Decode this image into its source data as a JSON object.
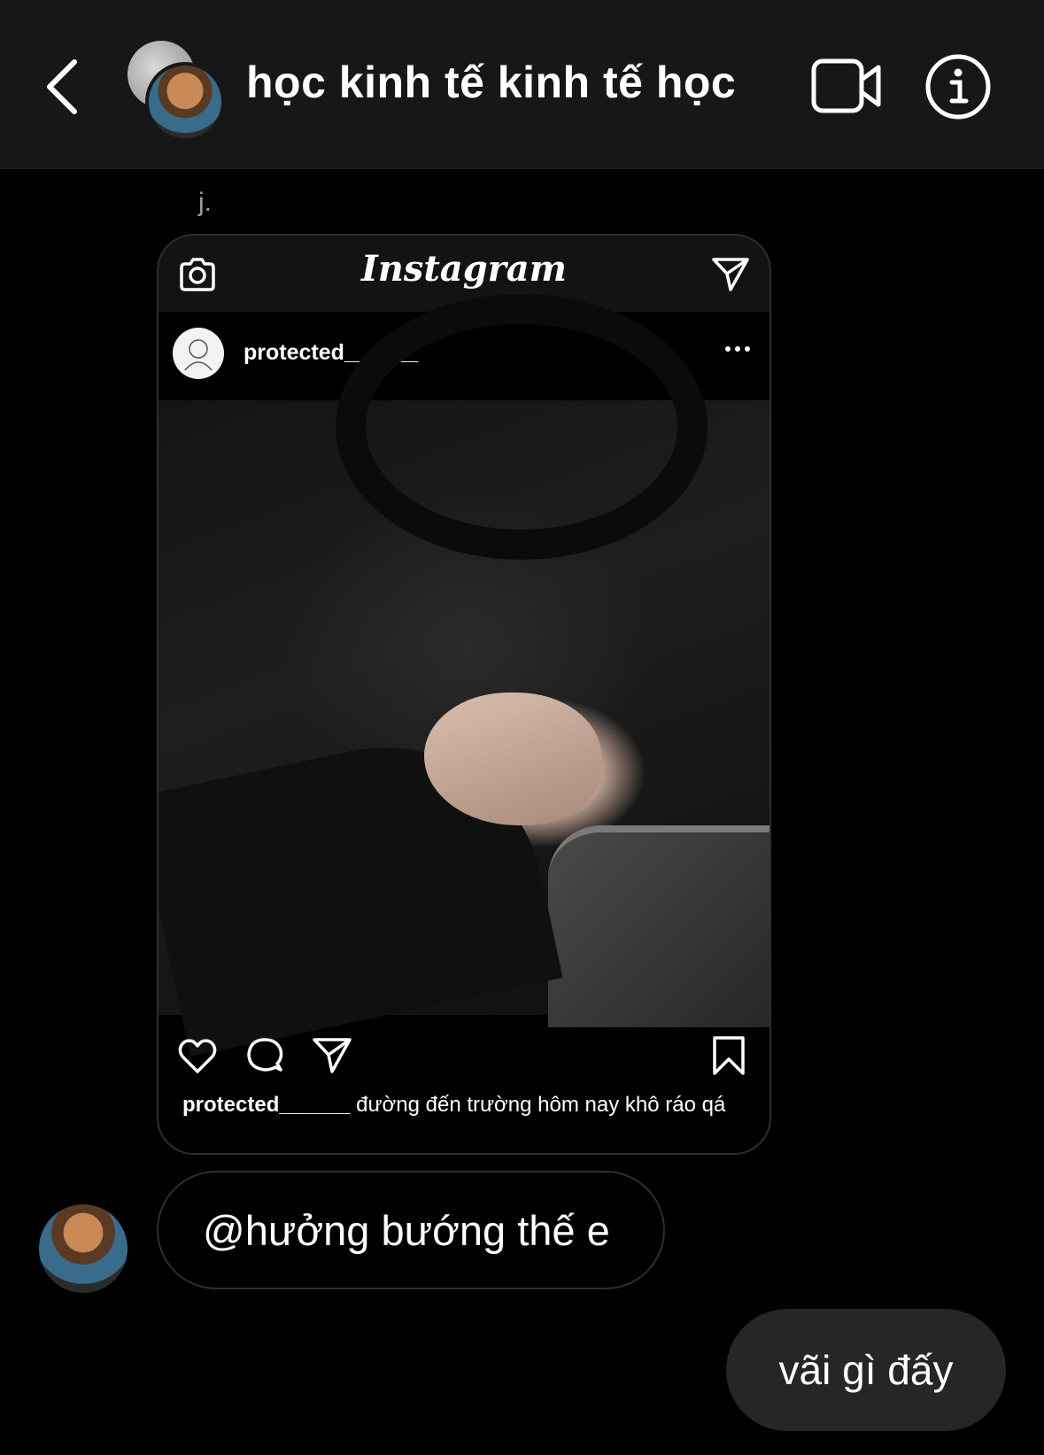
{
  "header": {
    "title": "học kinh tế kinh tế học",
    "icons": [
      "back-chevron-icon",
      "video-camera-icon",
      "info-icon"
    ]
  },
  "messages": {
    "sender_name": "j.",
    "shared_post": {
      "app_logo": "Instagram",
      "username": "protected______",
      "caption_user": "protected______",
      "caption_text": " đường đến trường hôm nay khô ráo qá",
      "icons": [
        "camera-icon",
        "paper-plane-icon",
        "more-dots-icon",
        "heart-icon",
        "comment-icon",
        "share-icon",
        "bookmark-icon"
      ]
    },
    "reply_text": "@hưởng bướng thế e",
    "my_reply_text": "vãi gì đấy"
  },
  "colors": {
    "background": "#000000",
    "header_bg": "#171717",
    "outgoing_bubble": "#262626",
    "border": "#2e2e2e",
    "muted_text": "#9a9a9a"
  }
}
